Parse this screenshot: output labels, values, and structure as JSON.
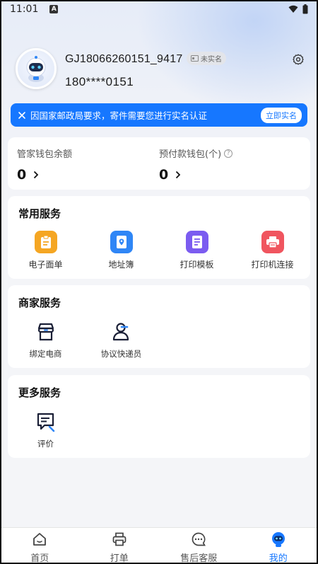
{
  "status_bar": {
    "time": "11:01",
    "notif_icon": "A"
  },
  "profile": {
    "username": "GJ18066260151_9417",
    "verify_tag": "未实名",
    "phone": "180****0151"
  },
  "banner": {
    "message": "因国家邮政局要求，寄件需要您进行实名认证",
    "action": "立即实名"
  },
  "wallet": {
    "manager_label": "管家钱包余额",
    "manager_value": "0",
    "prepaid_label": "预付款钱包(个)",
    "prepaid_value": "0"
  },
  "common_services": {
    "title": "常用服务",
    "items": [
      {
        "label": "电子面单",
        "icon": "clipboard-icon",
        "color": "#f5a623"
      },
      {
        "label": "地址簿",
        "icon": "address-book-icon",
        "color": "#2f86f6"
      },
      {
        "label": "打印模板",
        "icon": "template-icon",
        "color": "#7b5cf0"
      },
      {
        "label": "打印机连接",
        "icon": "printer-icon",
        "color": "#f0555f"
      }
    ]
  },
  "merchant_services": {
    "title": "商家服务",
    "items": [
      {
        "label": "绑定电商",
        "icon": "shop-icon"
      },
      {
        "label": "协议快递员",
        "icon": "courier-icon"
      }
    ]
  },
  "more_services": {
    "title": "更多服务",
    "items": [
      {
        "label": "评价",
        "icon": "review-icon"
      }
    ]
  },
  "tabbar": {
    "items": [
      {
        "label": "首页",
        "icon": "home-icon",
        "active": false
      },
      {
        "label": "打单",
        "icon": "printer-icon",
        "active": false
      },
      {
        "label": "售后客服",
        "icon": "chat-icon",
        "active": false
      },
      {
        "label": "我的",
        "icon": "robot-icon",
        "active": true
      }
    ]
  },
  "colors": {
    "accent": "#1677ff",
    "background": "#f4f5f8"
  }
}
